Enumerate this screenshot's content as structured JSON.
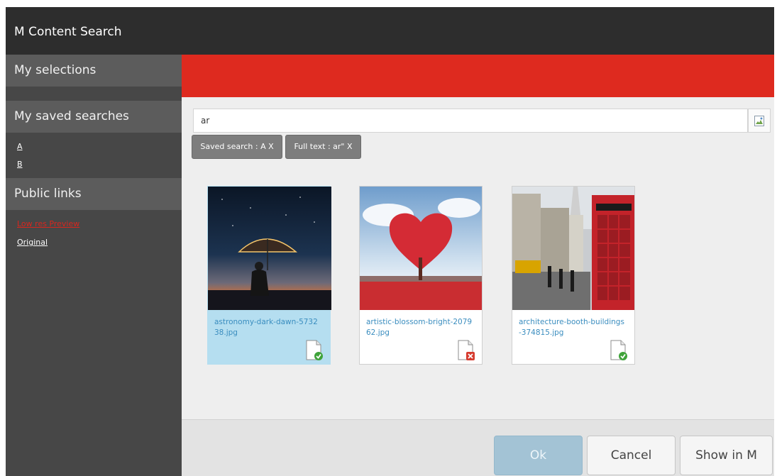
{
  "window": {
    "title": "M Content Search"
  },
  "sidebar": {
    "selections_label": "My selections",
    "saved_searches_label": "My saved searches",
    "saved_searches": [
      "A",
      "B"
    ],
    "public_links_label": "Public links",
    "public_links": [
      "Low res Preview",
      "Original"
    ]
  },
  "search": {
    "value": "ar"
  },
  "filters": [
    "Saved search : A X",
    "Full text : ar\" X"
  ],
  "results": [
    {
      "filename": "astronomy-dark-dawn-573238.jpg",
      "selected": true,
      "status": "ok"
    },
    {
      "filename": "artistic-blossom-bright-207962.jpg",
      "selected": false,
      "status": "error"
    },
    {
      "filename": "architecture-booth-buildings-374815.jpg",
      "selected": false,
      "status": "ok"
    }
  ],
  "footer": {
    "ok_label": "Ok",
    "cancel_label": "Cancel",
    "show_label": "Show in M"
  },
  "colors": {
    "banner": "#de2a1f",
    "title_bar": "#2d2d2d",
    "sidebar": "#474747",
    "selected_card": "#b5def0"
  },
  "icons": {
    "search_button": "broken-image-icon",
    "status_ok": "file-check-icon",
    "status_error": "file-error-icon"
  }
}
